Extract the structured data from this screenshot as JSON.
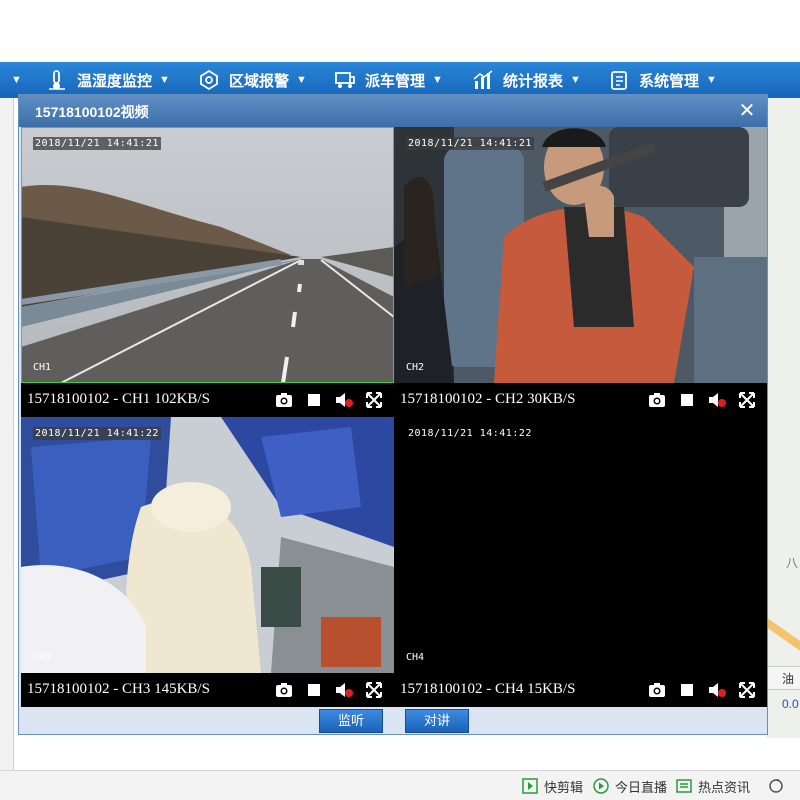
{
  "nav": {
    "items": [
      {
        "label": "",
        "icon": "partial-menu-icon"
      },
      {
        "label": "温湿度监控",
        "icon": "thermometer-icon"
      },
      {
        "label": "区域报警",
        "icon": "region-alarm-icon"
      },
      {
        "label": "派车管理",
        "icon": "dispatch-icon"
      },
      {
        "label": "统计报表",
        "icon": "bar-chart-icon"
      },
      {
        "label": "系统管理",
        "icon": "system-settings-icon"
      }
    ],
    "caret": "▼"
  },
  "dialog": {
    "title": "15718100102视频",
    "close_glyph": "✕",
    "tiles": [
      {
        "label": "15718100102 - CH1 102KB/S",
        "timestamp": "2018/11/21 14:41:21",
        "channel": "CH1",
        "selected": true
      },
      {
        "label": "15718100102 - CH2 30KB/S",
        "timestamp": "2018/11/21 14:41:21",
        "channel": "CH2",
        "selected": false
      },
      {
        "label": "15718100102 - CH3 145KB/S",
        "timestamp": "2018/11/21 14:41:22",
        "channel": "CH3",
        "selected": false
      },
      {
        "label": "15718100102 - CH4 15KB/S",
        "timestamp": "2018/11/21 14:41:22",
        "channel": "CH4",
        "selected": false
      }
    ],
    "buttons": {
      "monitor": "监听",
      "intercom": "对讲"
    }
  },
  "background": {
    "map_label": "八",
    "grid_header_partial": "油",
    "grid_cell_partial": "0.0"
  },
  "taskbar": {
    "items": [
      {
        "label": "快剪辑",
        "icon": "video-edit-icon"
      },
      {
        "label": "今日直播",
        "icon": "live-play-icon"
      },
      {
        "label": "热点资讯",
        "icon": "news-icon"
      }
    ]
  },
  "colors": {
    "nav_bg": "#1f74c8",
    "dialog_title": "#4b7db6",
    "selected_border": "#3ad13a",
    "button": "#2a74cc"
  }
}
